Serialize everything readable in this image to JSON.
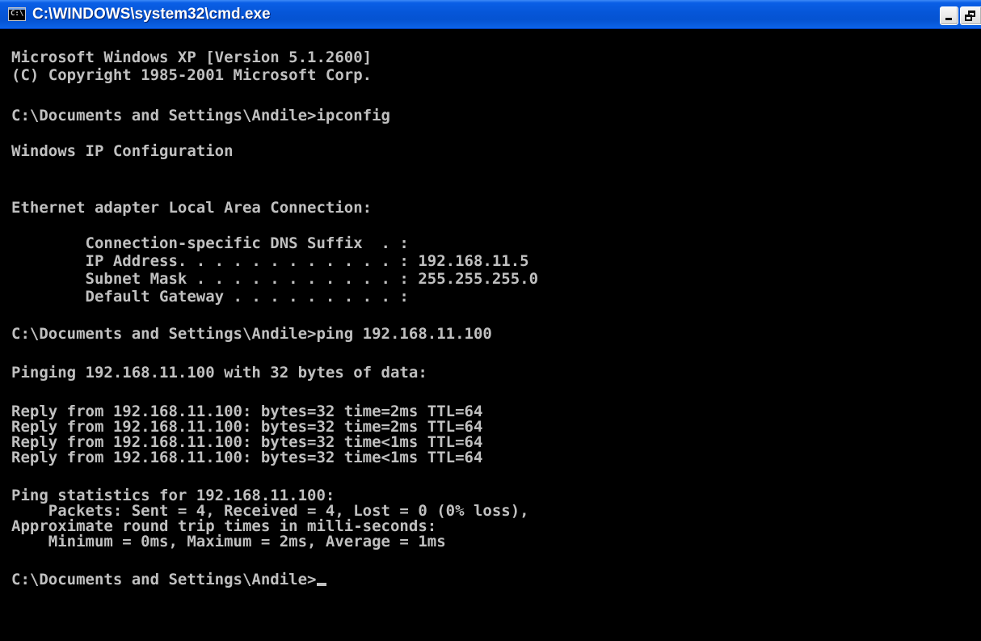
{
  "window": {
    "title": "C:\\WINDOWS\\system32\\cmd.exe",
    "icon": "command-prompt-icon",
    "icon_glyph": "C:\\",
    "controls": [
      "minimize-icon",
      "restore-icon"
    ]
  },
  "colors": {
    "titlebar": "#0553d2",
    "console_bg": "#000000",
    "console_text": "#c0c0c0"
  },
  "console": {
    "lines": [
      "Microsoft Windows XP [Version 5.1.2600]",
      "(C) Copyright 1985-2001 Microsoft Corp.",
      "C:\\Documents and Settings\\Andile>ipconfig",
      "Windows IP Configuration",
      "Ethernet adapter Local Area Connection:",
      "        Connection-specific DNS Suffix  . :",
      "        IP Address. . . . . . . . . . . . : 192.168.11.5",
      "        Subnet Mask . . . . . . . . . . . : 255.255.255.0",
      "        Default Gateway . . . . . . . . . :",
      "C:\\Documents and Settings\\Andile>ping 192.168.11.100",
      "Pinging 192.168.11.100 with 32 bytes of data:",
      "Reply from 192.168.11.100: bytes=32 time=2ms TTL=64",
      "Reply from 192.168.11.100: bytes=32 time=2ms TTL=64",
      "Reply from 192.168.11.100: bytes=32 time<1ms TTL=64",
      "Reply from 192.168.11.100: bytes=32 time<1ms TTL=64",
      "Ping statistics for 192.168.11.100:",
      "    Packets: Sent = 4, Received = 4, Lost = 0 (0% loss),",
      "Approximate round trip times in milli-seconds:",
      "    Minimum = 0ms, Maximum = 2ms, Average = 1ms",
      "C:\\Documents and Settings\\Andile>"
    ]
  }
}
